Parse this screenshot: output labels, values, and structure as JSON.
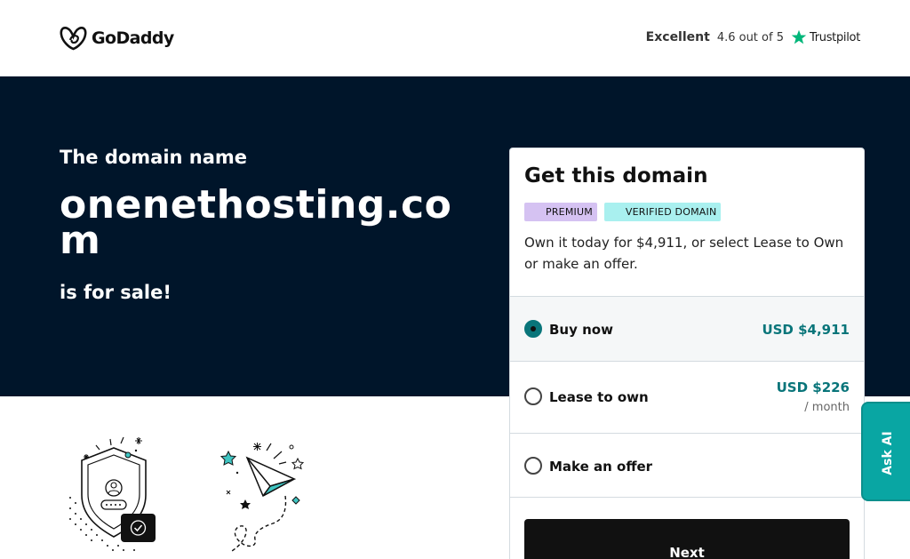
{
  "header": {
    "logo_text": "GoDaddy",
    "rating": {
      "label": "Excellent",
      "score": "4.6 out of 5",
      "provider": "Trustpilot"
    }
  },
  "hero": {
    "intro": "The domain name",
    "domain": "onenethosting.com",
    "sale_text": "is for sale!"
  },
  "card": {
    "title": "Get this domain",
    "badges": [
      "PREMIUM",
      "VERIFIED DOMAIN"
    ],
    "description": "Own it today for $4,911, or select Lease to Own or make an offer.",
    "options": [
      {
        "label": "Buy now",
        "price": "USD $4,911",
        "selected": true
      },
      {
        "label": "Lease to own",
        "price": "USD $226",
        "sub": "/ month",
        "selected": false
      },
      {
        "label": "Make an offer",
        "selected": false
      }
    ],
    "next_label": "Next"
  },
  "ask_ai": {
    "label": "Ask AI"
  },
  "icons": {
    "logo": "godaddy-logo-icon",
    "trustpilot": "trustpilot-star-icon",
    "shield": "shield-illustration-icon",
    "plane": "paper-plane-illustration-icon"
  },
  "colors": {
    "hero_background": "#00152a",
    "accent_teal": "#09757a",
    "ask_ai_background": "#09a6a3",
    "trustpilot_green": "#00b67a",
    "badge_premium": "#d5c2f2",
    "badge_verified": "#a9f0ef",
    "button_dark": "#111111"
  }
}
